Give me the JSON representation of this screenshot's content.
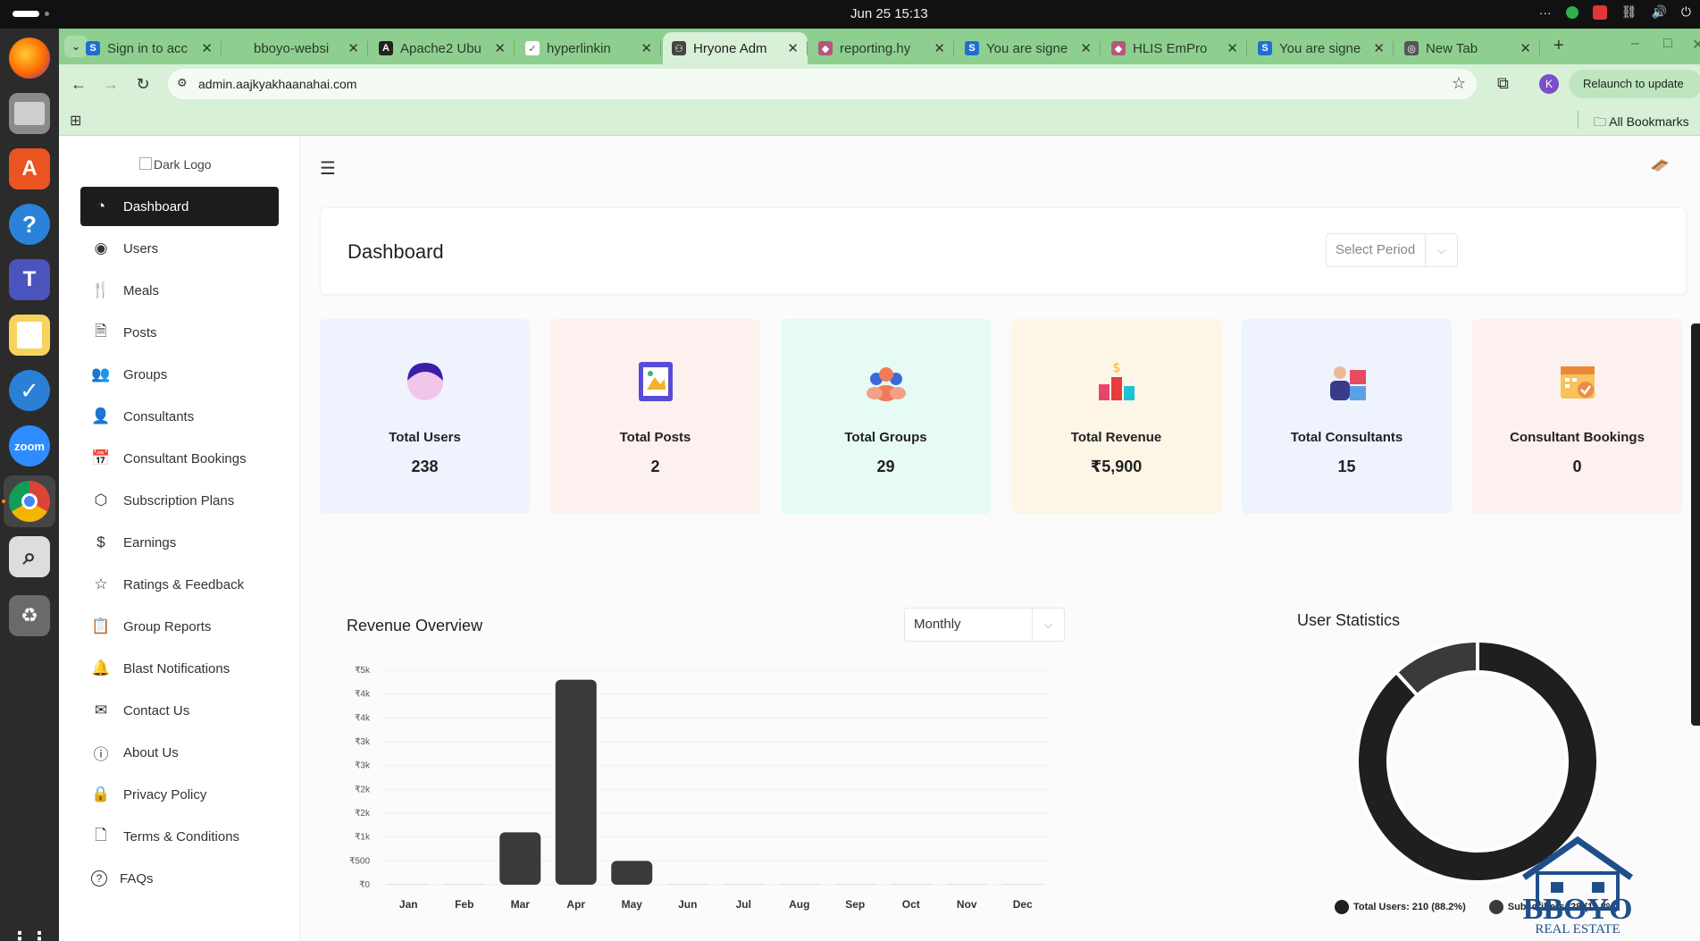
{
  "os": {
    "clock": "Jun 25  15:13",
    "tray_more": "···"
  },
  "browser": {
    "tabs": [
      {
        "title": "Sign in to acc",
        "fav": "S",
        "fav_color": "#1f6fd1"
      },
      {
        "title": "bboyo-websi",
        "fav": "",
        "fav_color": "#8ecf8f"
      },
      {
        "title": "Apache2 Ubu",
        "fav": "A",
        "fav_color": "#222222"
      },
      {
        "title": "hyperlinkin",
        "fav": "✓",
        "fav_color": "#ffffff"
      },
      {
        "title": "Hryone Adm",
        "fav": "⚇",
        "fav_color": "#444444"
      },
      {
        "title": "reporting.hy",
        "fav": "◆",
        "fav_color": "#b5577a"
      },
      {
        "title": "You are signe",
        "fav": "S",
        "fav_color": "#1f6fd1"
      },
      {
        "title": "HLIS EmPro",
        "fav": "◆",
        "fav_color": "#b5577a"
      },
      {
        "title": "You are signe",
        "fav": "S",
        "fav_color": "#1f6fd1"
      },
      {
        "title": "New Tab",
        "fav": "◎",
        "fav_color": "#555555"
      }
    ],
    "active_tab": 4,
    "url": "admin.aajkyakhaanahai.com",
    "profile_initial": "K",
    "relaunch_label": "Relaunch to update",
    "all_bookmarks": "All Bookmarks"
  },
  "sidebar": {
    "logo_alt": "Dark Logo",
    "items": [
      {
        "label": "Dashboard",
        "icon": "dashboard-icon"
      },
      {
        "label": "Users",
        "icon": "user-circle-icon"
      },
      {
        "label": "Meals",
        "icon": "fork-knife-icon"
      },
      {
        "label": "Posts",
        "icon": "document-icon"
      },
      {
        "label": "Groups",
        "icon": "group-icon"
      },
      {
        "label": "Consultants",
        "icon": "person-icon"
      },
      {
        "label": "Consultant Bookings",
        "icon": "calendar-icon"
      },
      {
        "label": "Subscription Plans",
        "icon": "box-icon"
      },
      {
        "label": "Earnings",
        "icon": "dollar-icon"
      },
      {
        "label": "Ratings & Feedback",
        "icon": "star-icon"
      },
      {
        "label": "Group Reports",
        "icon": "clipboard-icon"
      },
      {
        "label": "Blast Notifications",
        "icon": "bell-icon"
      },
      {
        "label": "Contact Us",
        "icon": "envelope-icon"
      },
      {
        "label": "About Us",
        "icon": "info-icon"
      },
      {
        "label": "Privacy Policy",
        "icon": "lock-icon"
      },
      {
        "label": "Terms & Conditions",
        "icon": "file-icon"
      },
      {
        "label": "FAQs",
        "icon": "question-icon"
      }
    ]
  },
  "header": {
    "title": "Dashboard",
    "period_placeholder": "Select Period"
  },
  "stats": [
    {
      "label": "Total Users",
      "value": "238",
      "bg": "#eef3fd"
    },
    {
      "label": "Total Posts",
      "value": "2",
      "bg": "#fcf1ee"
    },
    {
      "label": "Total Groups",
      "value": "29",
      "bg": "#e6fbf6"
    },
    {
      "label": "Total Revenue",
      "value": "₹5,900",
      "bg": "#fdf6e7"
    },
    {
      "label": "Total Consultants",
      "value": "15",
      "bg": "#eef3fd"
    },
    {
      "label": "Consultant Bookings",
      "value": "0",
      "bg": "#fcf1ee"
    }
  ],
  "revenue": {
    "title": "Revenue Overview",
    "period": "Monthly"
  },
  "user_stats": {
    "title": "User Statistics"
  },
  "chart_data": [
    {
      "type": "bar",
      "title": "Revenue Overview",
      "categories": [
        "Jan",
        "Feb",
        "Mar",
        "Apr",
        "May",
        "Jun",
        "Jul",
        "Aug",
        "Sep",
        "Oct",
        "Nov",
        "Dec"
      ],
      "values": [
        0,
        0,
        1100,
        4300,
        500,
        0,
        0,
        0,
        0,
        0,
        0,
        0
      ],
      "ytick_labels": [
        "₹0",
        "₹500",
        "₹1k",
        "₹2k",
        "₹2k",
        "₹3k",
        "₹3k",
        "₹4k",
        "₹4k",
        "₹5k"
      ],
      "ytick_values": [
        0,
        500,
        1000,
        1500,
        2000,
        2500,
        3000,
        3500,
        4000,
        4500
      ],
      "ylim": [
        0,
        4500
      ],
      "color": "#3a3a3a",
      "grid": true
    },
    {
      "type": "pie",
      "title": "User Statistics",
      "labels": [
        "Total Users: 210 (88.2%)",
        "Subscribers: 28 (11.8%)"
      ],
      "values": [
        210,
        28
      ],
      "colors": [
        "#1f1f1f",
        "#3a3a3a"
      ],
      "donut": true,
      "legend": "bottom"
    }
  ],
  "watermark": {
    "brand": "BBOYO",
    "sub": "REAL ESTATE"
  }
}
